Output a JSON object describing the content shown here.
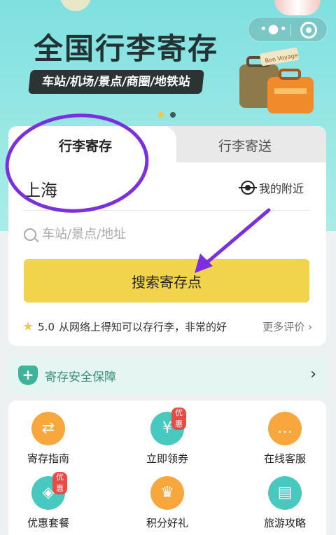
{
  "banner": {
    "title": "全国行李寄存",
    "tagline": "车站/机场/景点/商圈/地铁站",
    "luggage_sticker": "Bon Voyage"
  },
  "tabs": [
    {
      "label": "行李寄存",
      "active": true
    },
    {
      "label": "行李寄送",
      "active": false
    }
  ],
  "search": {
    "city": "上海",
    "nearby_label": "我的附近",
    "placeholder": "车站/景点/地址",
    "button_label": "搜索寄存点"
  },
  "review": {
    "rating": "5.0",
    "text": "从网络上得知可以存行李，非常的好",
    "more_label": "更多评价"
  },
  "safety": {
    "label": "寄存安全保障"
  },
  "grid": [
    {
      "label": "寄存指南",
      "icon": "signpost-icon",
      "color": "orange",
      "badge": ""
    },
    {
      "label": "立即领券",
      "icon": "coupon-icon",
      "color": "teal",
      "badge": "优惠"
    },
    {
      "label": "在线客服",
      "icon": "chat-icon",
      "color": "orange",
      "badge": ""
    },
    {
      "label": "优惠套餐",
      "icon": "tag-icon",
      "color": "teal",
      "badge": "优惠"
    },
    {
      "label": "积分好礼",
      "icon": "crown-icon",
      "color": "orange",
      "badge": ""
    },
    {
      "label": "旅游攻略",
      "icon": "guidebook-icon",
      "color": "teal",
      "badge": ""
    }
  ],
  "colors": {
    "accent_yellow": "#f2d34c",
    "banner_teal": "#7fe0e0",
    "annotation_purple": "#7b2fe0"
  }
}
